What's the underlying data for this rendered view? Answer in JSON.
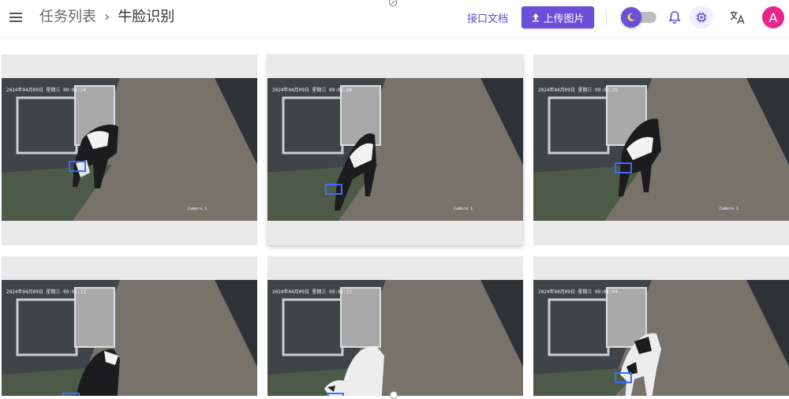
{
  "header": {
    "breadcrumb_parent": "任务列表",
    "breadcrumb_separator": "›",
    "breadcrumb_current": "牛脸识别",
    "api_docs_label": "接口文档",
    "upload_label": "上传图片",
    "avatar_letter": "A",
    "icons": [
      "menu-icon",
      "upload-icon",
      "theme-toggle-icon",
      "bell-icon",
      "chip-icon",
      "translate-icon"
    ]
  },
  "gallery": {
    "cards": [
      {
        "timestamp": "2024年04月09日 星期三 09:01:24",
        "camera": "Camera 1"
      },
      {
        "timestamp": "2024年04月09日 星期三 09:01:24",
        "camera": "Camera 1"
      },
      {
        "timestamp": "2024年04月09日 星期三 09:01:29",
        "camera": "Camera 1"
      },
      {
        "timestamp": "2024年04月09日 星期三 09:01:11",
        "camera": ""
      },
      {
        "timestamp": "2024年04月09日 星期三 09:01:13",
        "camera": ""
      },
      {
        "timestamp": "2024年04月09日 星期三 09:01:04",
        "camera": ""
      }
    ]
  },
  "colors": {
    "accent": "#6a4fd8",
    "avatar": "#e8258a",
    "card_background": "#e9e9e9"
  }
}
